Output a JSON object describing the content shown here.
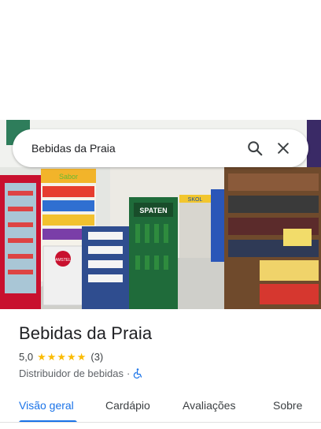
{
  "search": {
    "query": "Bebidas da Praia",
    "search_icon": "search-icon",
    "close_icon": "close-icon"
  },
  "photo": {
    "subject": "store-interior-photo",
    "shelf_sign_left": "Sabor",
    "shelf_sign_right": "SKOL",
    "fridge_brand": "SPATEN",
    "cooler_brand": "AMSTEL"
  },
  "place": {
    "name": "Bebidas da Praia",
    "rating": "5,0",
    "stars": 5,
    "review_count": "(3)",
    "category": "Distribuidor de bebidas",
    "separator": "·",
    "accessibility_icon": "wheelchair-icon"
  },
  "tabs": [
    {
      "label": "Visão geral",
      "active": true
    },
    {
      "label": "Cardápio",
      "active": false
    },
    {
      "label": "Avaliações",
      "active": false
    },
    {
      "label": "Sobre",
      "active": false
    }
  ],
  "colors": {
    "accent": "#1a73e8",
    "star": "#fbbc04",
    "text": "#202124",
    "secondary_text": "#5f6368"
  }
}
